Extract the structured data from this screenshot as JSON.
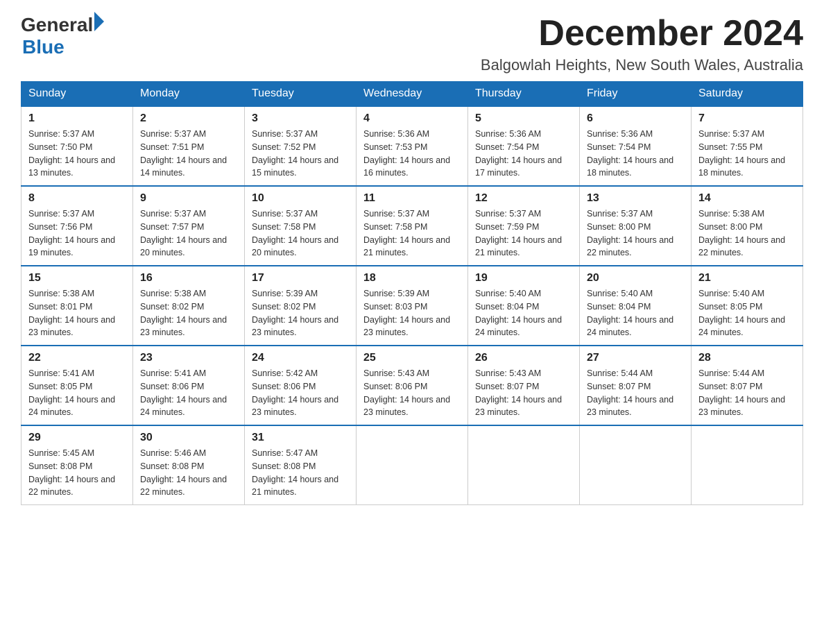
{
  "header": {
    "logo": {
      "general": "General",
      "blue": "Blue"
    },
    "month_title": "December 2024",
    "location": "Balgowlah Heights, New South Wales, Australia"
  },
  "weekdays": [
    "Sunday",
    "Monday",
    "Tuesday",
    "Wednesday",
    "Thursday",
    "Friday",
    "Saturday"
  ],
  "weeks": [
    [
      {
        "day": "1",
        "sunrise": "5:37 AM",
        "sunset": "7:50 PM",
        "daylight": "14 hours and 13 minutes."
      },
      {
        "day": "2",
        "sunrise": "5:37 AM",
        "sunset": "7:51 PM",
        "daylight": "14 hours and 14 minutes."
      },
      {
        "day": "3",
        "sunrise": "5:37 AM",
        "sunset": "7:52 PM",
        "daylight": "14 hours and 15 minutes."
      },
      {
        "day": "4",
        "sunrise": "5:36 AM",
        "sunset": "7:53 PM",
        "daylight": "14 hours and 16 minutes."
      },
      {
        "day": "5",
        "sunrise": "5:36 AM",
        "sunset": "7:54 PM",
        "daylight": "14 hours and 17 minutes."
      },
      {
        "day": "6",
        "sunrise": "5:36 AM",
        "sunset": "7:54 PM",
        "daylight": "14 hours and 18 minutes."
      },
      {
        "day": "7",
        "sunrise": "5:37 AM",
        "sunset": "7:55 PM",
        "daylight": "14 hours and 18 minutes."
      }
    ],
    [
      {
        "day": "8",
        "sunrise": "5:37 AM",
        "sunset": "7:56 PM",
        "daylight": "14 hours and 19 minutes."
      },
      {
        "day": "9",
        "sunrise": "5:37 AM",
        "sunset": "7:57 PM",
        "daylight": "14 hours and 20 minutes."
      },
      {
        "day": "10",
        "sunrise": "5:37 AM",
        "sunset": "7:58 PM",
        "daylight": "14 hours and 20 minutes."
      },
      {
        "day": "11",
        "sunrise": "5:37 AM",
        "sunset": "7:58 PM",
        "daylight": "14 hours and 21 minutes."
      },
      {
        "day": "12",
        "sunrise": "5:37 AM",
        "sunset": "7:59 PM",
        "daylight": "14 hours and 21 minutes."
      },
      {
        "day": "13",
        "sunrise": "5:37 AM",
        "sunset": "8:00 PM",
        "daylight": "14 hours and 22 minutes."
      },
      {
        "day": "14",
        "sunrise": "5:38 AM",
        "sunset": "8:00 PM",
        "daylight": "14 hours and 22 minutes."
      }
    ],
    [
      {
        "day": "15",
        "sunrise": "5:38 AM",
        "sunset": "8:01 PM",
        "daylight": "14 hours and 23 minutes."
      },
      {
        "day": "16",
        "sunrise": "5:38 AM",
        "sunset": "8:02 PM",
        "daylight": "14 hours and 23 minutes."
      },
      {
        "day": "17",
        "sunrise": "5:39 AM",
        "sunset": "8:02 PM",
        "daylight": "14 hours and 23 minutes."
      },
      {
        "day": "18",
        "sunrise": "5:39 AM",
        "sunset": "8:03 PM",
        "daylight": "14 hours and 23 minutes."
      },
      {
        "day": "19",
        "sunrise": "5:40 AM",
        "sunset": "8:04 PM",
        "daylight": "14 hours and 24 minutes."
      },
      {
        "day": "20",
        "sunrise": "5:40 AM",
        "sunset": "8:04 PM",
        "daylight": "14 hours and 24 minutes."
      },
      {
        "day": "21",
        "sunrise": "5:40 AM",
        "sunset": "8:05 PM",
        "daylight": "14 hours and 24 minutes."
      }
    ],
    [
      {
        "day": "22",
        "sunrise": "5:41 AM",
        "sunset": "8:05 PM",
        "daylight": "14 hours and 24 minutes."
      },
      {
        "day": "23",
        "sunrise": "5:41 AM",
        "sunset": "8:06 PM",
        "daylight": "14 hours and 24 minutes."
      },
      {
        "day": "24",
        "sunrise": "5:42 AM",
        "sunset": "8:06 PM",
        "daylight": "14 hours and 23 minutes."
      },
      {
        "day": "25",
        "sunrise": "5:43 AM",
        "sunset": "8:06 PM",
        "daylight": "14 hours and 23 minutes."
      },
      {
        "day": "26",
        "sunrise": "5:43 AM",
        "sunset": "8:07 PM",
        "daylight": "14 hours and 23 minutes."
      },
      {
        "day": "27",
        "sunrise": "5:44 AM",
        "sunset": "8:07 PM",
        "daylight": "14 hours and 23 minutes."
      },
      {
        "day": "28",
        "sunrise": "5:44 AM",
        "sunset": "8:07 PM",
        "daylight": "14 hours and 23 minutes."
      }
    ],
    [
      {
        "day": "29",
        "sunrise": "5:45 AM",
        "sunset": "8:08 PM",
        "daylight": "14 hours and 22 minutes."
      },
      {
        "day": "30",
        "sunrise": "5:46 AM",
        "sunset": "8:08 PM",
        "daylight": "14 hours and 22 minutes."
      },
      {
        "day": "31",
        "sunrise": "5:47 AM",
        "sunset": "8:08 PM",
        "daylight": "14 hours and 21 minutes."
      },
      null,
      null,
      null,
      null
    ]
  ],
  "labels": {
    "sunrise": "Sunrise:",
    "sunset": "Sunset:",
    "daylight": "Daylight:"
  }
}
